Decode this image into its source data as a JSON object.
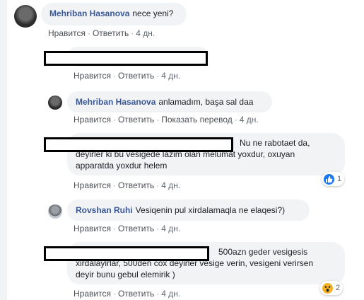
{
  "actions": {
    "like": "Нравится",
    "reply": "Ответить",
    "translate": "Показать перевод"
  },
  "comments": [
    {
      "author": "Mehriban Hasanova",
      "text": "nece yeni?",
      "time": "4 дн."
    },
    {
      "author": "",
      "text": "",
      "time": "4 дн."
    },
    {
      "author": "Mehriban Hasanova",
      "text": "anlamadım, başa sal daa",
      "time": "4 дн."
    },
    {
      "author": "",
      "text_line1": "Nu ne rabotaet da,",
      "text_line2": "deyirler ki bu vesigede lazim olan melumat yoxdur, oxuyan",
      "text_line3": "apparatda yoxdur helem",
      "time": "4 дн.",
      "reaction_count": "1",
      "reaction_icon": "like-icon"
    },
    {
      "author": "Rovshan Ruhi",
      "text": "Vesiqenin pul xirdalamaqla ne elaqesi?)",
      "time": "4 дн."
    },
    {
      "author": "",
      "text_line1": "500azn geder vesigesis",
      "text_line2": "xirdalayirlar, 500den cox deyirler vesige verin, vesigeni verirsen",
      "text_line3": "deyir bunu gebul elemirik )",
      "time": "4 дн.",
      "reaction_count": "2",
      "reaction_icon": "wow-icon"
    }
  ],
  "colors": {
    "author": "#385898",
    "bubble": "#f2f3f5",
    "like": "#1877f2"
  }
}
